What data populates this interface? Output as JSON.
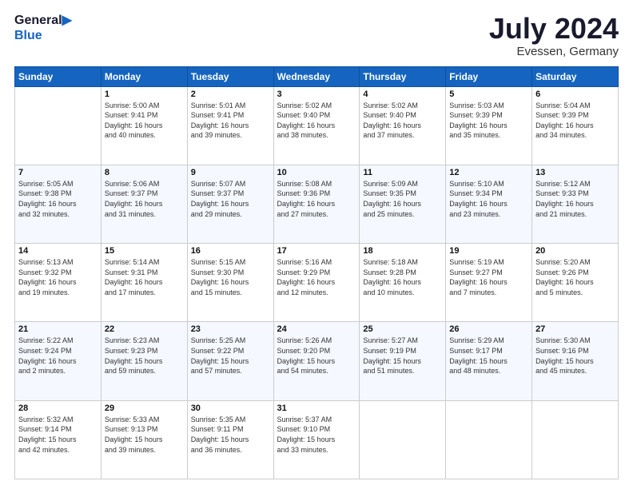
{
  "logo": {
    "line1": "General",
    "line2": "Blue"
  },
  "title": "July 2024",
  "subtitle": "Evessen, Germany",
  "weekdays": [
    "Sunday",
    "Monday",
    "Tuesday",
    "Wednesday",
    "Thursday",
    "Friday",
    "Saturday"
  ],
  "weeks": [
    [
      {
        "day": "",
        "sunrise": "",
        "sunset": "",
        "daylight": ""
      },
      {
        "day": "1",
        "sunrise": "Sunrise: 5:00 AM",
        "sunset": "Sunset: 9:41 PM",
        "daylight": "Daylight: 16 hours and 40 minutes."
      },
      {
        "day": "2",
        "sunrise": "Sunrise: 5:01 AM",
        "sunset": "Sunset: 9:41 PM",
        "daylight": "Daylight: 16 hours and 39 minutes."
      },
      {
        "day": "3",
        "sunrise": "Sunrise: 5:02 AM",
        "sunset": "Sunset: 9:40 PM",
        "daylight": "Daylight: 16 hours and 38 minutes."
      },
      {
        "day": "4",
        "sunrise": "Sunrise: 5:02 AM",
        "sunset": "Sunset: 9:40 PM",
        "daylight": "Daylight: 16 hours and 37 minutes."
      },
      {
        "day": "5",
        "sunrise": "Sunrise: 5:03 AM",
        "sunset": "Sunset: 9:39 PM",
        "daylight": "Daylight: 16 hours and 35 minutes."
      },
      {
        "day": "6",
        "sunrise": "Sunrise: 5:04 AM",
        "sunset": "Sunset: 9:39 PM",
        "daylight": "Daylight: 16 hours and 34 minutes."
      }
    ],
    [
      {
        "day": "7",
        "sunrise": "Sunrise: 5:05 AM",
        "sunset": "Sunset: 9:38 PM",
        "daylight": "Daylight: 16 hours and 32 minutes."
      },
      {
        "day": "8",
        "sunrise": "Sunrise: 5:06 AM",
        "sunset": "Sunset: 9:37 PM",
        "daylight": "Daylight: 16 hours and 31 minutes."
      },
      {
        "day": "9",
        "sunrise": "Sunrise: 5:07 AM",
        "sunset": "Sunset: 9:37 PM",
        "daylight": "Daylight: 16 hours and 29 minutes."
      },
      {
        "day": "10",
        "sunrise": "Sunrise: 5:08 AM",
        "sunset": "Sunset: 9:36 PM",
        "daylight": "Daylight: 16 hours and 27 minutes."
      },
      {
        "day": "11",
        "sunrise": "Sunrise: 5:09 AM",
        "sunset": "Sunset: 9:35 PM",
        "daylight": "Daylight: 16 hours and 25 minutes."
      },
      {
        "day": "12",
        "sunrise": "Sunrise: 5:10 AM",
        "sunset": "Sunset: 9:34 PM",
        "daylight": "Daylight: 16 hours and 23 minutes."
      },
      {
        "day": "13",
        "sunrise": "Sunrise: 5:12 AM",
        "sunset": "Sunset: 9:33 PM",
        "daylight": "Daylight: 16 hours and 21 minutes."
      }
    ],
    [
      {
        "day": "14",
        "sunrise": "Sunrise: 5:13 AM",
        "sunset": "Sunset: 9:32 PM",
        "daylight": "Daylight: 16 hours and 19 minutes."
      },
      {
        "day": "15",
        "sunrise": "Sunrise: 5:14 AM",
        "sunset": "Sunset: 9:31 PM",
        "daylight": "Daylight: 16 hours and 17 minutes."
      },
      {
        "day": "16",
        "sunrise": "Sunrise: 5:15 AM",
        "sunset": "Sunset: 9:30 PM",
        "daylight": "Daylight: 16 hours and 15 minutes."
      },
      {
        "day": "17",
        "sunrise": "Sunrise: 5:16 AM",
        "sunset": "Sunset: 9:29 PM",
        "daylight": "Daylight: 16 hours and 12 minutes."
      },
      {
        "day": "18",
        "sunrise": "Sunrise: 5:18 AM",
        "sunset": "Sunset: 9:28 PM",
        "daylight": "Daylight: 16 hours and 10 minutes."
      },
      {
        "day": "19",
        "sunrise": "Sunrise: 5:19 AM",
        "sunset": "Sunset: 9:27 PM",
        "daylight": "Daylight: 16 hours and 7 minutes."
      },
      {
        "day": "20",
        "sunrise": "Sunrise: 5:20 AM",
        "sunset": "Sunset: 9:26 PM",
        "daylight": "Daylight: 16 hours and 5 minutes."
      }
    ],
    [
      {
        "day": "21",
        "sunrise": "Sunrise: 5:22 AM",
        "sunset": "Sunset: 9:24 PM",
        "daylight": "Daylight: 16 hours and 2 minutes."
      },
      {
        "day": "22",
        "sunrise": "Sunrise: 5:23 AM",
        "sunset": "Sunset: 9:23 PM",
        "daylight": "Daylight: 15 hours and 59 minutes."
      },
      {
        "day": "23",
        "sunrise": "Sunrise: 5:25 AM",
        "sunset": "Sunset: 9:22 PM",
        "daylight": "Daylight: 15 hours and 57 minutes."
      },
      {
        "day": "24",
        "sunrise": "Sunrise: 5:26 AM",
        "sunset": "Sunset: 9:20 PM",
        "daylight": "Daylight: 15 hours and 54 minutes."
      },
      {
        "day": "25",
        "sunrise": "Sunrise: 5:27 AM",
        "sunset": "Sunset: 9:19 PM",
        "daylight": "Daylight: 15 hours and 51 minutes."
      },
      {
        "day": "26",
        "sunrise": "Sunrise: 5:29 AM",
        "sunset": "Sunset: 9:17 PM",
        "daylight": "Daylight: 15 hours and 48 minutes."
      },
      {
        "day": "27",
        "sunrise": "Sunrise: 5:30 AM",
        "sunset": "Sunset: 9:16 PM",
        "daylight": "Daylight: 15 hours and 45 minutes."
      }
    ],
    [
      {
        "day": "28",
        "sunrise": "Sunrise: 5:32 AM",
        "sunset": "Sunset: 9:14 PM",
        "daylight": "Daylight: 15 hours and 42 minutes."
      },
      {
        "day": "29",
        "sunrise": "Sunrise: 5:33 AM",
        "sunset": "Sunset: 9:13 PM",
        "daylight": "Daylight: 15 hours and 39 minutes."
      },
      {
        "day": "30",
        "sunrise": "Sunrise: 5:35 AM",
        "sunset": "Sunset: 9:11 PM",
        "daylight": "Daylight: 15 hours and 36 minutes."
      },
      {
        "day": "31",
        "sunrise": "Sunrise: 5:37 AM",
        "sunset": "Sunset: 9:10 PM",
        "daylight": "Daylight: 15 hours and 33 minutes."
      },
      {
        "day": "",
        "sunrise": "",
        "sunset": "",
        "daylight": ""
      },
      {
        "day": "",
        "sunrise": "",
        "sunset": "",
        "daylight": ""
      },
      {
        "day": "",
        "sunrise": "",
        "sunset": "",
        "daylight": ""
      }
    ]
  ]
}
